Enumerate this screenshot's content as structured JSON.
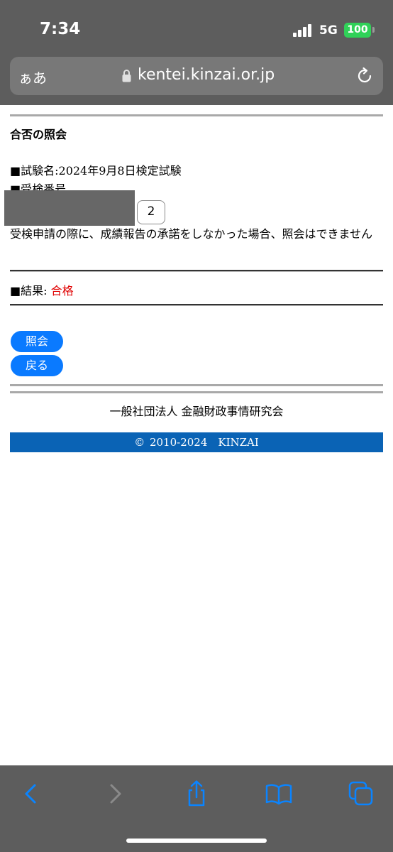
{
  "status_bar": {
    "time": "7:34",
    "network": "5G",
    "battery": "100"
  },
  "browser": {
    "text_size_label": "ぁあ",
    "url": "kentei.kinzai.or.jp"
  },
  "page": {
    "heading": "合否の照会",
    "exam_name": "■試験名:2024年9月8日検定試験",
    "examinee_number_label": "■受検番号",
    "examinee_number_check_digit": "2",
    "notice": "受検申請の際に、成績報告の承諾をしなかった場合、照会はできません",
    "result_label": "■結果: ",
    "result_value": "合格",
    "buttons": {
      "inquiry": "照会",
      "back": "戻る"
    },
    "organization": "一般社団法人 金融財政事情研究会",
    "copyright": "© 2010-2024　KINZAI"
  },
  "colors": {
    "link_blue": "#0a7aff",
    "footer_blue": "#0a63b5",
    "result_red": "#e00000"
  },
  "toolbar": {
    "icons": [
      "back-icon",
      "forward-icon",
      "share-icon",
      "bookmarks-icon",
      "tabs-icon"
    ]
  }
}
